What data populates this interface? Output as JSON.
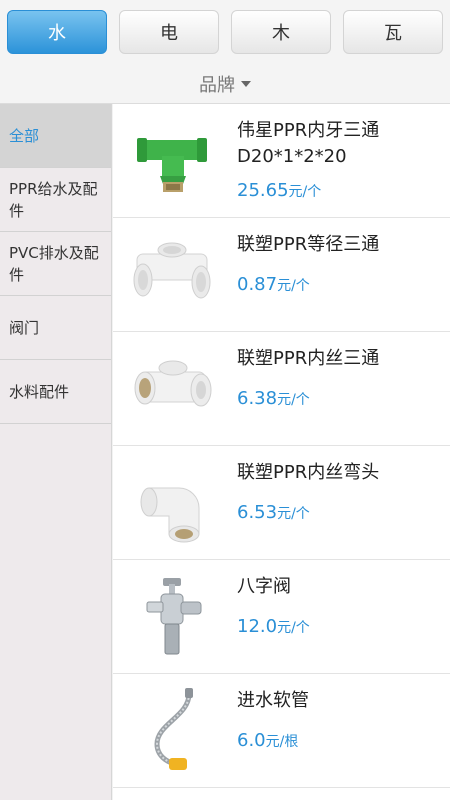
{
  "tabs": [
    {
      "label": "水",
      "active": true
    },
    {
      "label": "电",
      "active": false
    },
    {
      "label": "木",
      "active": false
    },
    {
      "label": "瓦",
      "active": false
    }
  ],
  "filter": {
    "brand_label": "品牌"
  },
  "sidebar": {
    "items": [
      {
        "label": "全部",
        "active": true
      },
      {
        "label": "PPR给水及配件",
        "active": false
      },
      {
        "label": "PVC排水及配件",
        "active": false
      },
      {
        "label": "阀门",
        "active": false
      },
      {
        "label": "水料配件",
        "active": false
      }
    ]
  },
  "products": [
    {
      "name": "伟星PPR内牙三通D20*1*2*20",
      "price": "25.65",
      "unit": "元/个"
    },
    {
      "name": "联塑PPR等径三通",
      "price": "0.87",
      "unit": "元/个"
    },
    {
      "name": "联塑PPR内丝三通",
      "price": "6.38",
      "unit": "元/个"
    },
    {
      "name": "联塑PPR内丝弯头",
      "price": "6.53",
      "unit": "元/个"
    },
    {
      "name": "八字阀",
      "price": "12.0",
      "unit": "元/个"
    },
    {
      "name": "进水软管",
      "price": "6.0",
      "unit": "元/根"
    }
  ]
}
